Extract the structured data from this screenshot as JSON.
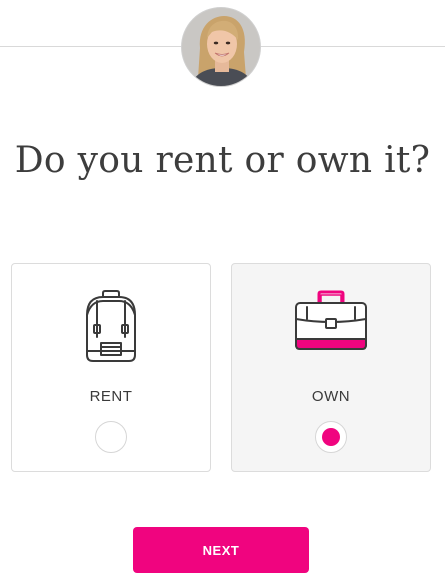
{
  "question": "Do you rent or own it?",
  "options": [
    {
      "label": "RENT",
      "icon": "backpack-icon",
      "selected": false
    },
    {
      "label": "OWN",
      "icon": "briefcase-icon",
      "selected": true
    }
  ],
  "next_label": "NEXT",
  "colors": {
    "accent": "#f0047f",
    "border": "#dcdcdc",
    "selected_bg": "#f5f5f5"
  },
  "avatar": {
    "icon": "advisor-avatar"
  }
}
